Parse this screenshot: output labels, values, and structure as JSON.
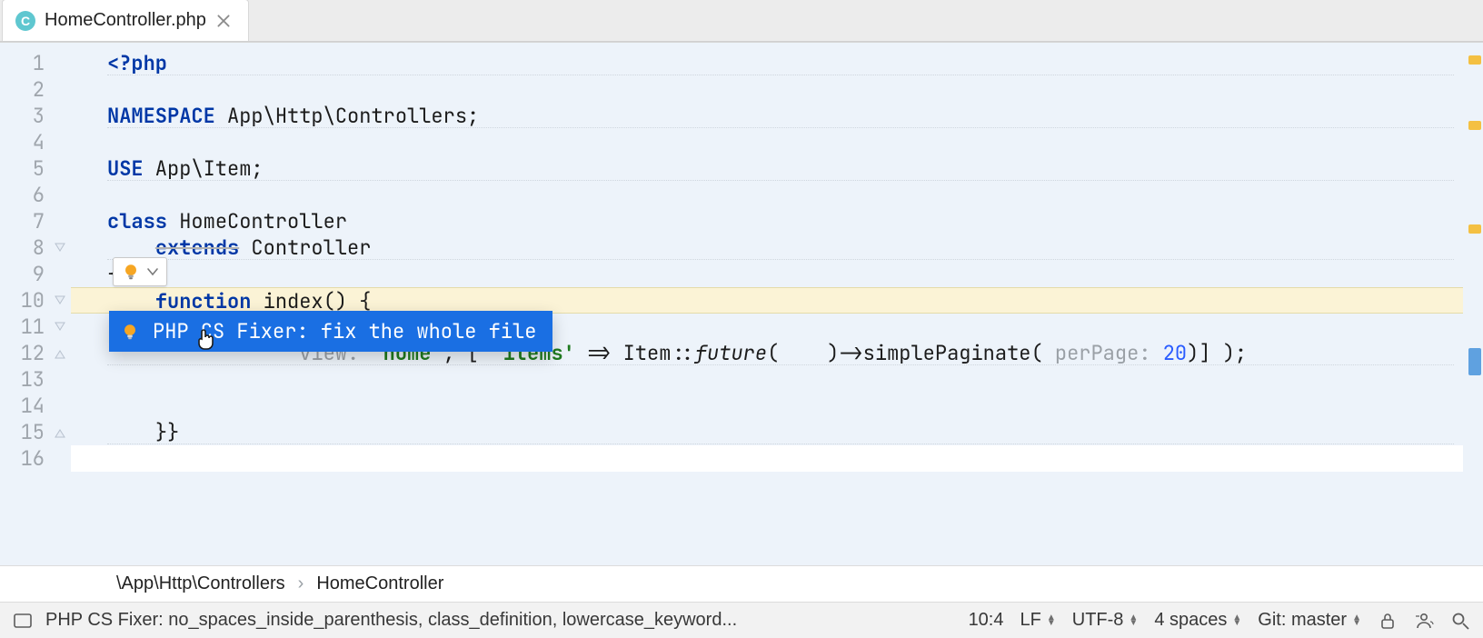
{
  "tab": {
    "file_icon_letter": "C",
    "filename": "HomeController.php"
  },
  "gutter": {
    "lines": [
      "1",
      "2",
      "3",
      "4",
      "5",
      "6",
      "7",
      "8",
      "9",
      "10",
      "11",
      "12",
      "13",
      "14",
      "15",
      "16"
    ]
  },
  "code": {
    "l1": {
      "php_open": "<?php"
    },
    "l3": {
      "kw": "NAMESPACE",
      "ns": " App\\Http\\Controllers;"
    },
    "l5": {
      "kw": "USE",
      "ns": " App\\Item;"
    },
    "l7": {
      "kw": "class",
      "name": " HomeController"
    },
    "l8": {
      "kw": "extends",
      "name": " Controller"
    },
    "l9": {
      "brace": "{"
    },
    "l10": {
      "kw": "function",
      "sig": " index() {"
    },
    "l12": {
      "pre": "                ",
      "hint_view": "view:",
      "sp1": " ",
      "str_home": "'home'",
      "mid1": ", [ ",
      "str_items": "'items'",
      "mid2": " => Item::",
      "fn_future": "future",
      "mid3": "(    )->simplePaginate( ",
      "hint_pp": "perPage:",
      "sp2": " ",
      "num": "20",
      "mid4": ")] );"
    },
    "l15": {
      "braces": "}}"
    }
  },
  "intention": {
    "popup_label": "PHP CS Fixer: fix the whole file"
  },
  "breadcrumb": {
    "a": "\\App\\Http\\Controllers",
    "sep": "›",
    "b": "HomeController"
  },
  "status": {
    "inspection": "PHP CS Fixer: no_spaces_inside_parenthesis, class_definition, lowercase_keyword...",
    "caret": "10:4",
    "line_sep": "LF",
    "encoding": "UTF-8",
    "indent": "4 spaces",
    "vcs": "Git: master"
  }
}
